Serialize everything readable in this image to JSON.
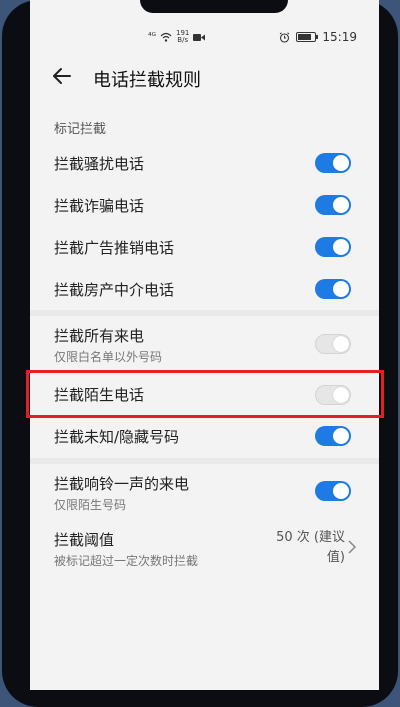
{
  "status_bar": {
    "network": "⁴ᴳ",
    "speed_value": "191",
    "speed_unit": "B/s",
    "time": "15:19"
  },
  "header": {
    "title": "电话拦截规则"
  },
  "section": {
    "label": "标记拦截"
  },
  "rows": [
    {
      "label": "拦截骚扰电话",
      "toggle": "on"
    },
    {
      "label": "拦截诈骗电话",
      "toggle": "on"
    },
    {
      "label": "拦截广告推销电话",
      "toggle": "on"
    },
    {
      "label": "拦截房产中介电话",
      "toggle": "on"
    },
    {
      "label": "拦截所有来电",
      "sub": "仅限白名单以外号码",
      "toggle": "off"
    },
    {
      "label": "拦截陌生电话",
      "toggle": "off"
    },
    {
      "label": "拦截未知/隐藏号码",
      "toggle": "on"
    },
    {
      "label": "拦截响铃一声的来电",
      "sub": "仅限陌生号码",
      "toggle": "on"
    },
    {
      "label": "拦截阈值",
      "sub": "被标记超过一定次数时拦截",
      "value_line1": "50 次 (建议",
      "value_line2": "值)"
    }
  ],
  "colors": {
    "accent": "#1e7be3",
    "highlight": "#e31e24",
    "background": "#f3f3f3"
  },
  "icons": [
    "back-arrow-icon",
    "signal-icon",
    "wifi-icon",
    "video-icon",
    "alarm-icon",
    "battery-icon",
    "chevron-right-icon"
  ]
}
